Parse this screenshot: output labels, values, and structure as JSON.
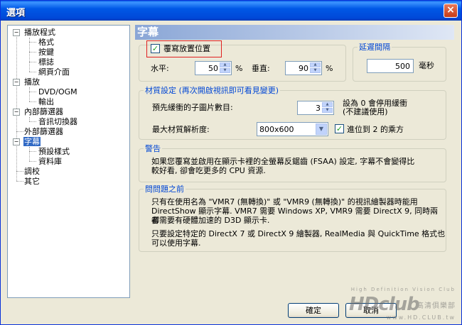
{
  "window": {
    "title": "選項",
    "close_label": "×"
  },
  "tree": {
    "items": [
      {
        "label": "播放程式",
        "level": 0,
        "expanded": true
      },
      {
        "label": "格式",
        "level": 1
      },
      {
        "label": "按鍵",
        "level": 1
      },
      {
        "label": "標誌",
        "level": 1
      },
      {
        "label": "網頁介面",
        "level": 1
      },
      {
        "label": "播放",
        "level": 0,
        "expanded": true
      },
      {
        "label": "DVD/OGM",
        "level": 1
      },
      {
        "label": "輸出",
        "level": 1
      },
      {
        "label": "內部篩選器",
        "level": 0,
        "expanded": true
      },
      {
        "label": "音訊切換器",
        "level": 1
      },
      {
        "label": "外部篩選器",
        "level": 0
      },
      {
        "label": "字幕",
        "level": 0,
        "expanded": true,
        "selected": true
      },
      {
        "label": "預設樣式",
        "level": 1
      },
      {
        "label": "資料庫",
        "level": 1
      },
      {
        "label": "調校",
        "level": 0
      },
      {
        "label": "其它",
        "level": 0
      }
    ]
  },
  "panel": {
    "title": "字幕",
    "override_position": {
      "label": "覆寫放置位置",
      "checked": true
    },
    "horizontal": {
      "label": "水平:",
      "value": "50",
      "unit": "%"
    },
    "vertical": {
      "label": "垂直:",
      "value": "90",
      "unit": "%"
    },
    "delay": {
      "title": "延遲間隔",
      "value": "500",
      "unit": "毫秒"
    },
    "texture": {
      "title": "材質設定 (再次開啟視訊即可看見變更)",
      "prebuffer_label": "預先緩衝的子圖片數目:",
      "prebuffer_value": "3",
      "prebuffer_note_1": "設為 0 會停用緩衝",
      "prebuffer_note_2": "(不建議使用)",
      "maxres_label": "最大材質解析度:",
      "maxres_value": "800x600",
      "pow2_label": "進位到 2 的乘方",
      "pow2_checked": true
    },
    "warning": {
      "title": "警告",
      "line1": "如果您覆寫並啟用在顯示卡裡的全螢幕反鋸齒 (FSAA) 設定, 字幕不會變得比",
      "line2": "較好看, 卻會吃更多的 CPU 資源."
    },
    "faq": {
      "title": "問問題之前",
      "line1": "只有在使用名為 \"VMR7 (無轉換)\" 或 \"VMR9 (無轉換)\" 的視訊繪製器時能用",
      "line2": "DirectShow 顯示字幕. VMR7 需要 Windows XP, VMR9 需要 DirectX 9, 同時兩者",
      "line3": "都需要有硬體加速的 D3D 顯示卡.",
      "line4": "只要設定特定的 DirectX 7 或 DirectX 9 繪製器, RealMedia 與 QuickTime 格式也",
      "line5": "可以使用字幕."
    }
  },
  "buttons": {
    "ok": "確定",
    "cancel": "取消"
  },
  "watermark": {
    "tagline": "High Definition Vision Club",
    "brand": "HDclub",
    "cn": "高清俱樂部",
    "url": "www.HD.CLUB.tw"
  }
}
